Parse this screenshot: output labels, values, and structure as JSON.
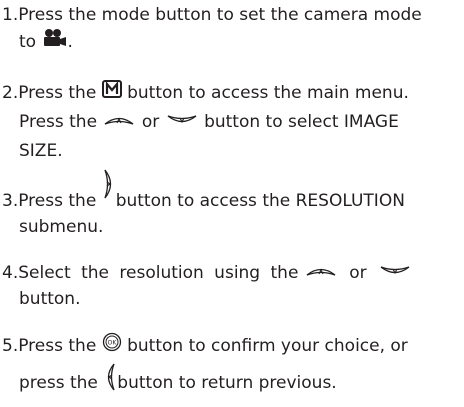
{
  "steps": [
    {
      "number": "1.",
      "a": "Press the mode button to set the camera mode",
      "b": "to",
      "c": ".",
      "icon": "movie-camera-icon"
    },
    {
      "number": "2.",
      "a": "Press the",
      "b": "button to access the main menu.",
      "c": "Press the",
      "d": "or",
      "e": "button to select IMAGE",
      "f": "SIZE.",
      "icons": [
        "menu-m-icon",
        "up-arrow-button-icon",
        "down-arrow-button-icon"
      ]
    },
    {
      "number": "3.",
      "a": "Press the",
      "b": "button to access the RESOLUTION",
      "c": "submenu.",
      "icon": "right-arrow-button-icon"
    },
    {
      "number": "4.",
      "a": "Select the resolution using the",
      "b": "or",
      "c": "button.",
      "icons": [
        "up-arrow-button-icon",
        "down-arrow-button-icon"
      ]
    },
    {
      "number": "5.",
      "a": "Press the",
      "b": "button to confirm your choice, or",
      "c": "press the",
      "d": "button to return previous.",
      "icons": [
        "ok-button-icon",
        "left-arrow-button-icon"
      ]
    }
  ]
}
